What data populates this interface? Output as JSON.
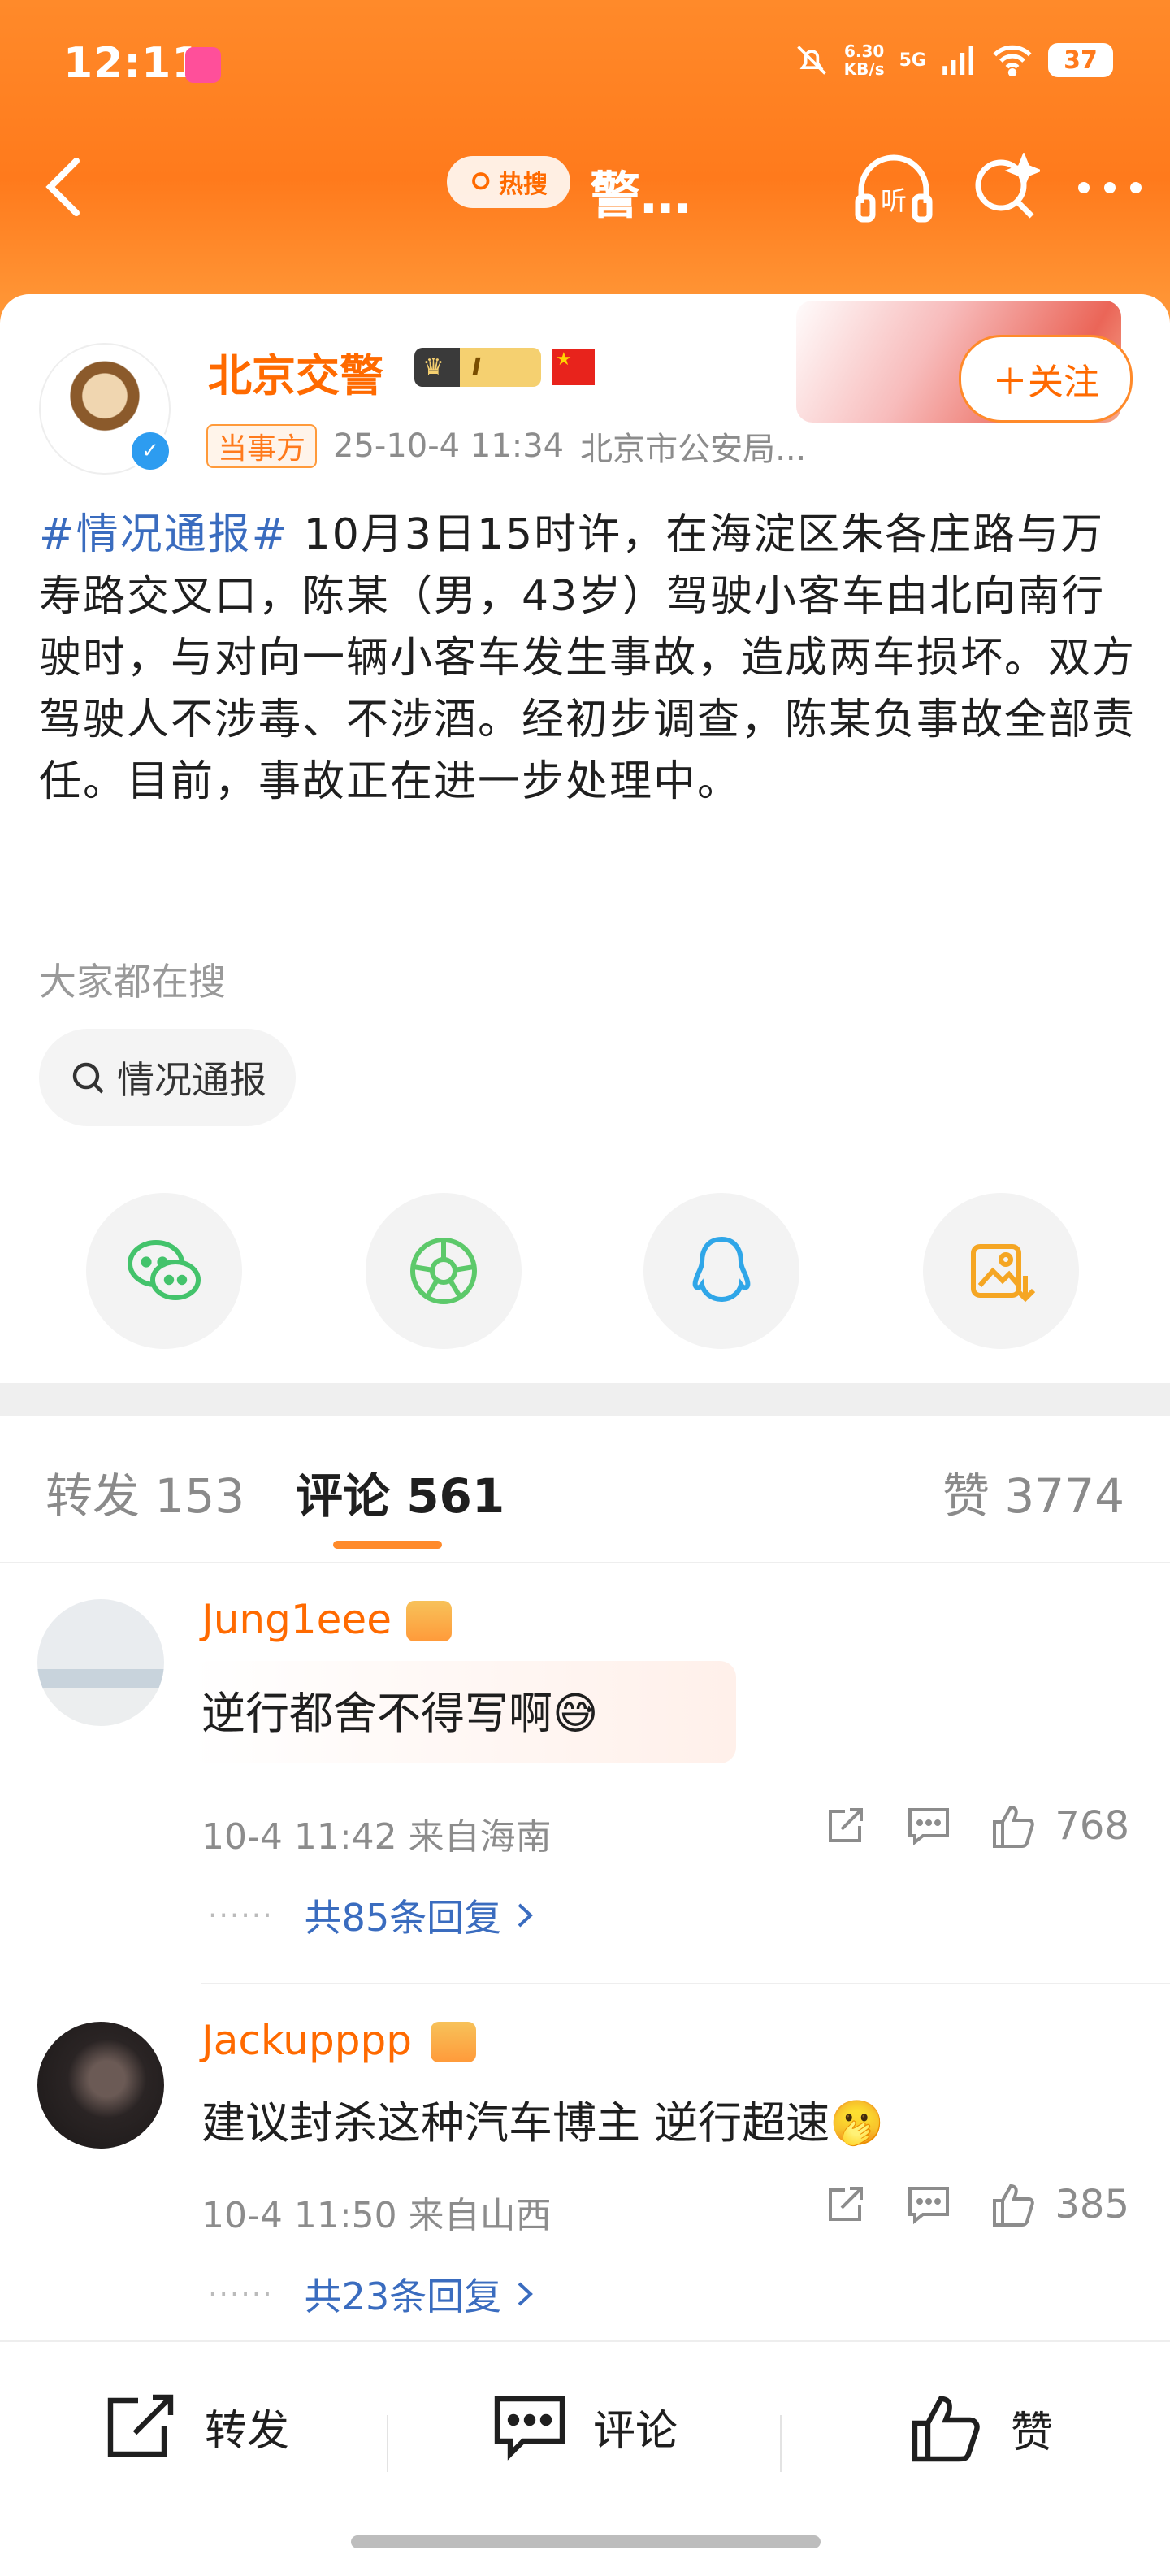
{
  "status_bar": {
    "time": "12:11",
    "net_speed_value": "6.30",
    "net_speed_unit": "KB/s",
    "network": "5G",
    "battery": "37"
  },
  "nav": {
    "hot_search_label": "热搜",
    "title": "警…"
  },
  "post": {
    "author": "北京交警",
    "level_badge": "I",
    "tag": "当事方",
    "timestamp": "25-10-4 11:34",
    "source": "北京市公安局...",
    "follow_label": "关注",
    "hashtag": "#情况通报#",
    "body": " 10月3日15时许，在海淀区朱各庄路与万寿路交叉口，陈某（男，43岁）驾驶小客车由北向南行驶时，与对向一辆小客车发生事故，造成两车损坏。双方驾驶人不涉毒、不涉酒。经初步调查，陈某负事故全部责任。目前，事故正在进一步处理中。"
  },
  "search": {
    "heading": "大家都在搜",
    "chip": "情况通报"
  },
  "tabs": {
    "repost": "转发 153",
    "comment": "评论 561",
    "like": "赞 3774"
  },
  "comments": [
    {
      "name": "Jung1eee",
      "text": "逆行都舍不得写啊😅",
      "time": "10-4 11:42 来自海南",
      "likes": "768",
      "replies": "共85条回复"
    },
    {
      "name": "Jackupppp",
      "text": "建议封杀这种汽车博主 逆行超速🫢",
      "time": "10-4 11:50 来自山西",
      "likes": "385",
      "replies": "共23条回复"
    }
  ],
  "bottom_bar": {
    "repost": "转发",
    "comment": "评论",
    "like": "赞"
  },
  "colors": {
    "brand_orange": "#ff7a1c",
    "link_blue": "#3a6cbf"
  }
}
